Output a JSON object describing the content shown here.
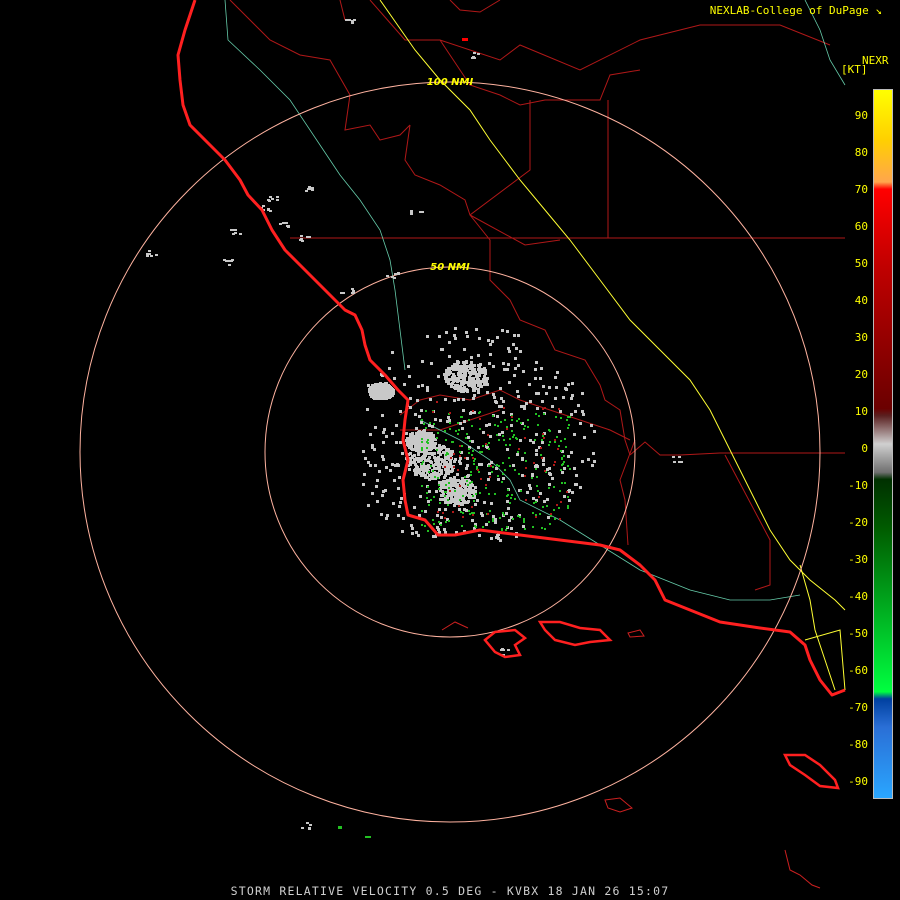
{
  "header": {
    "credit": "NEXLAB-College of DuPage",
    "credit_icon": "corner-arrow-icon",
    "product": "NEXR",
    "unit": "[KT]"
  },
  "rings": [
    {
      "label": "100 NMI"
    },
    {
      "label": "50 NMI"
    }
  ],
  "legend": {
    "ticks": [
      "90",
      "80",
      "70",
      "60",
      "50",
      "40",
      "30",
      "20",
      "10",
      "0",
      "-10",
      "-20",
      "-30",
      "-40",
      "-50",
      "-60",
      "-70",
      "-80",
      "-90"
    ],
    "colors": {
      "top": "#ffff00",
      "orange": "#ffa64d",
      "red": "#ff0000",
      "darkred": "#6b0000",
      "gray": "#d0d0d0",
      "darkgreen": "#005c00",
      "green": "#00ff40",
      "blue": "#2a6fd6",
      "lightblue": "#2aa6ff"
    }
  },
  "map_colors": {
    "coast": "#ff2020",
    "county": "#b01818",
    "river": "#7fffd4",
    "boundary": "#ffff33",
    "ring": "#ffb3a0",
    "echo": "#c8c8c8",
    "green_echo": "#22c022"
  },
  "footer": {
    "title": "STORM RELATIVE VELOCITY 0.5 DEG - KVBX 18 JAN 26 15:07"
  }
}
